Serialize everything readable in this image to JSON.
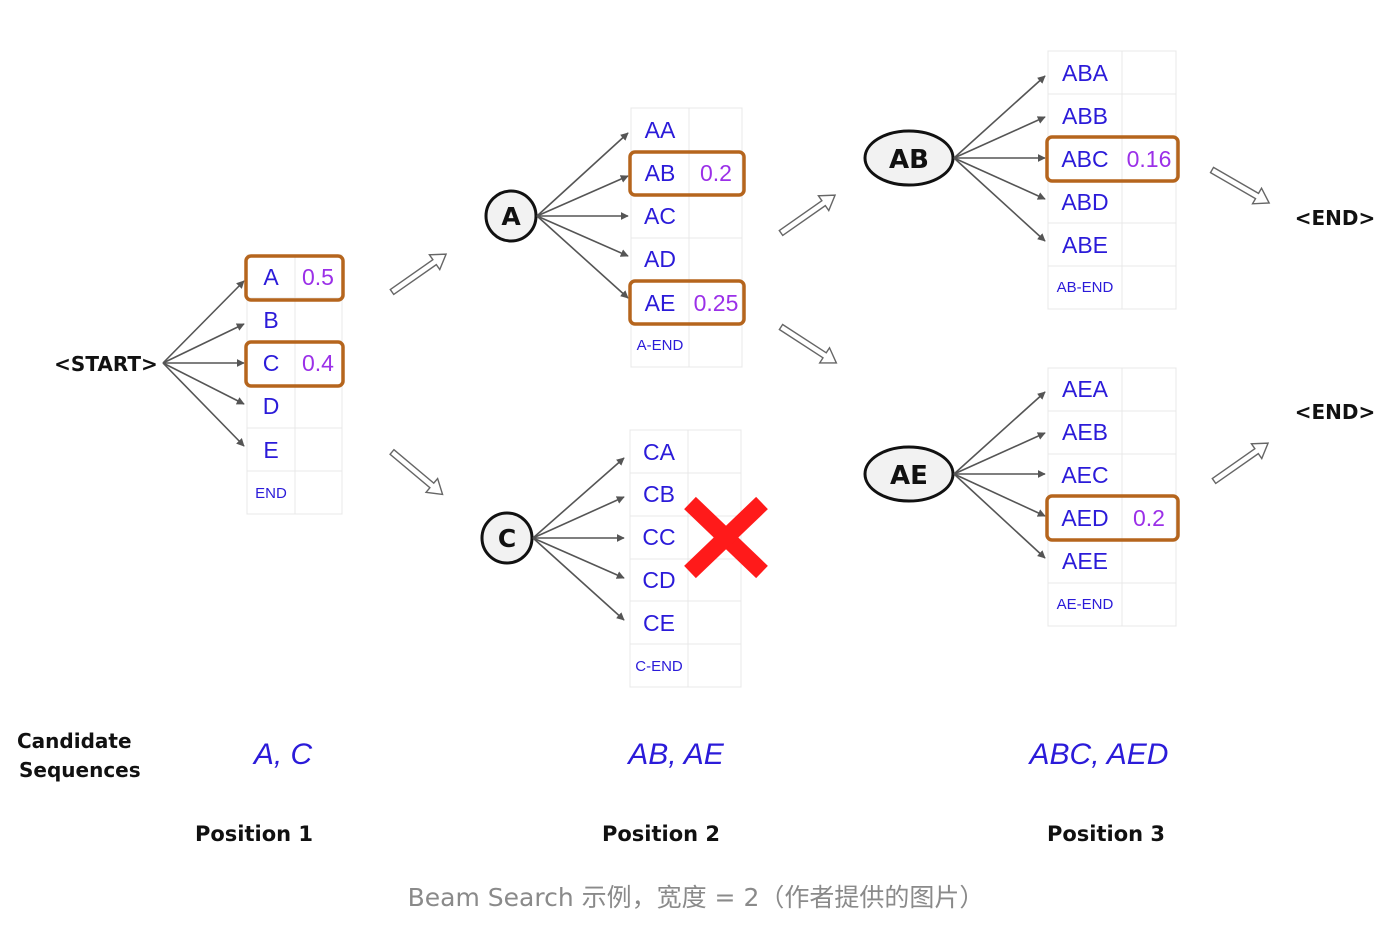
{
  "start_label": "<START>",
  "end_labels": [
    "<END>",
    "<END>"
  ],
  "cell_tokens": {
    "t1": [
      "A",
      "B",
      "C",
      "D",
      "E",
      "END"
    ],
    "t2a": [
      "AA",
      "AB",
      "AC",
      "AD",
      "AE",
      "A-END"
    ],
    "t2c": [
      "CA",
      "CB",
      "CC",
      "CD",
      "CE",
      "C-END"
    ],
    "t3ab": [
      "ABA",
      "ABB",
      "ABC",
      "ABD",
      "ABE",
      "AB-END"
    ],
    "t3ae": [
      "AEA",
      "AEB",
      "AEC",
      "AED",
      "AEE",
      "AE-END"
    ]
  },
  "probabilities": {
    "t1": [
      "0.5",
      "",
      "0.4",
      "",
      "",
      ""
    ],
    "t2a": [
      "",
      "0.2",
      "",
      "",
      "0.25",
      ""
    ],
    "t2c": [
      "",
      "",
      "",
      "",
      "",
      ""
    ],
    "t3ab": [
      "",
      "",
      "0.16",
      "",
      "",
      ""
    ],
    "t3ae": [
      "",
      "",
      "",
      "0.2",
      "",
      ""
    ]
  },
  "nodes": {
    "A": "A",
    "C": "C",
    "AB": "AB",
    "AE": "AE"
  },
  "candidate_heading": [
    "Candidate",
    "Sequences"
  ],
  "candidates": [
    "A, C",
    "AB, AE",
    "ABC, AED"
  ],
  "positions": [
    "Position 1",
    "Position 2",
    "Position 3"
  ],
  "caption": "Beam Search 示例，宽度 = 2（作者提供的图片）",
  "colors": {
    "token_text": "#2b1bd9",
    "probability_text": "#9b30e8",
    "highlight_box": "#b5651d",
    "pruned_cross": "#ff1a1a",
    "arrow": "#555555",
    "caption_text": "#8a8a8a"
  }
}
